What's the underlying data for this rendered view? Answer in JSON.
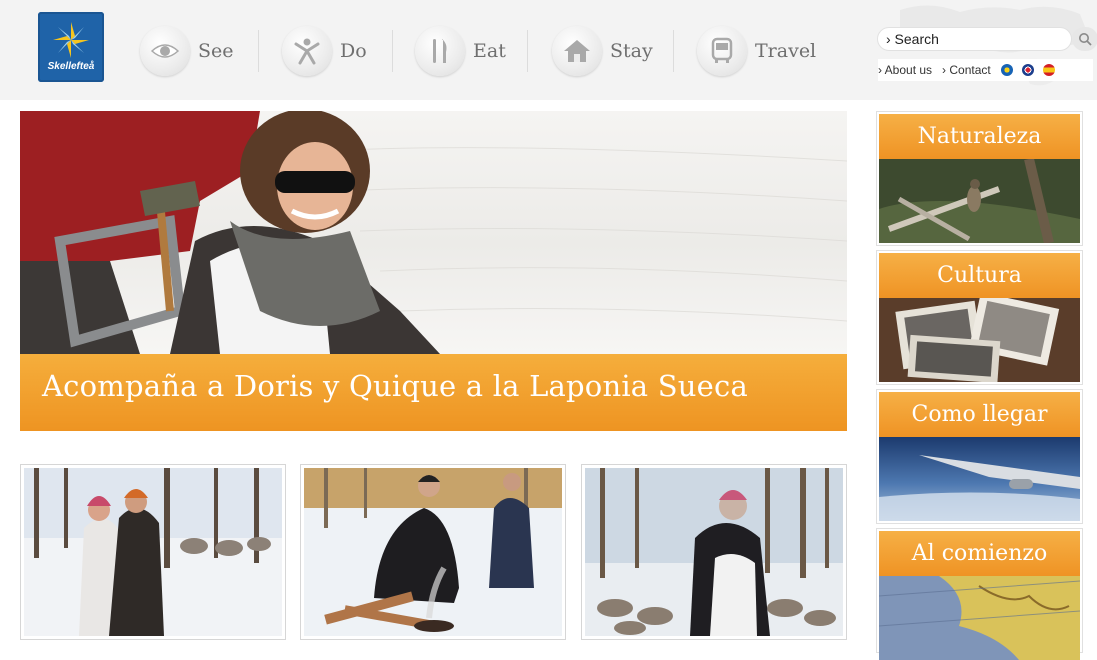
{
  "brand": {
    "logo_text": "Skellefteå"
  },
  "nav": {
    "items": [
      {
        "label": "See",
        "icon": "eye-icon"
      },
      {
        "label": "Do",
        "icon": "person-jump-icon"
      },
      {
        "label": "Eat",
        "icon": "fork-knife-icon"
      },
      {
        "label": "Stay",
        "icon": "house-icon"
      },
      {
        "label": "Travel",
        "icon": "bus-icon"
      }
    ]
  },
  "search": {
    "label": "› Search",
    "icon": "search-icon"
  },
  "toplinks": {
    "about": "› About us",
    "contact": "› Contact"
  },
  "languages": [
    "swedish-flag-icon",
    "uk-flag-icon",
    "spain-flag-icon"
  ],
  "hero": {
    "caption": "Acompaña a Doris y Quique a la Laponia Sueca"
  },
  "thumbnails": [
    {
      "alt": "couple-in-snow-forest-photo"
    },
    {
      "alt": "campfire-in-snow-photo"
    },
    {
      "alt": "reindeer-herd-photo"
    }
  ],
  "sidebar": {
    "cards": [
      {
        "title": "Naturaleza"
      },
      {
        "title": "Cultura"
      },
      {
        "title": "Como llegar"
      },
      {
        "title": "Al comienzo"
      }
    ]
  },
  "colors": {
    "accent_orange": "#f19a28",
    "header_bg": "#f3f3f3",
    "logo_blue": "#1f63a8"
  }
}
